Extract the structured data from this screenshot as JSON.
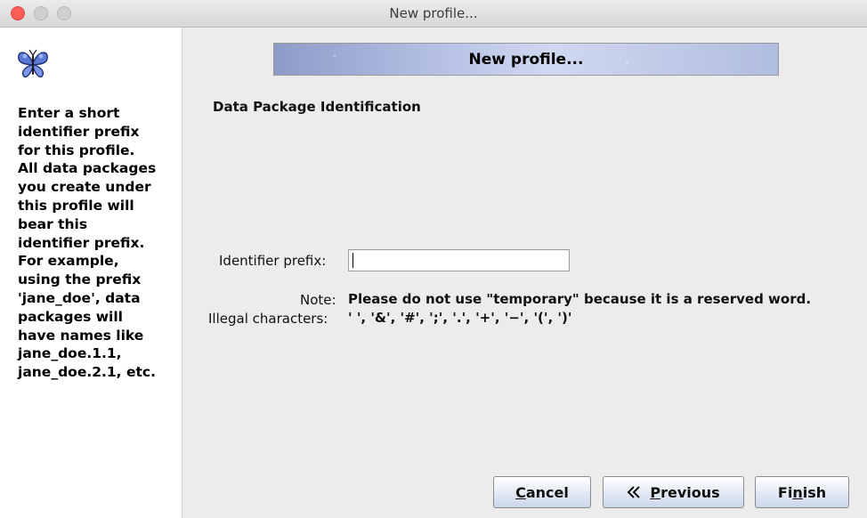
{
  "window": {
    "title": "New profile..."
  },
  "help_text": "Enter a short\nidentifier prefix\nfor this profile.\nAll data packages\nyou create under\nthis profile will\nbear this\nidentifier prefix.\nFor example,\nusing the prefix\n'jane_doe', data\npackages will\nhave names like\njane_doe.1.1,\njane_doe.2.1, etc.",
  "banner": {
    "title": "New profile..."
  },
  "section": {
    "title": "Data Package Identification"
  },
  "identifier": {
    "label": "Identifier prefix:",
    "value": ""
  },
  "note": {
    "label": "Note:",
    "text": "Please do not use \"temporary\" because it is a reserved word."
  },
  "illegal": {
    "label": "Illegal characters:",
    "text": "' ', '&', '#', ';', '.', '+', '−', '(', ')'"
  },
  "buttons": {
    "cancel": {
      "pre": "",
      "mnemonic": "C",
      "post": "ancel"
    },
    "previous": {
      "pre": "",
      "mnemonic": "P",
      "post": "revious",
      "icon": "double-chevron-left-icon"
    },
    "finish": {
      "pre": "Fi",
      "mnemonic": "n",
      "post": "ish"
    }
  },
  "colors": {
    "close": "#fc5d57",
    "banner": "#b8c3e6"
  }
}
